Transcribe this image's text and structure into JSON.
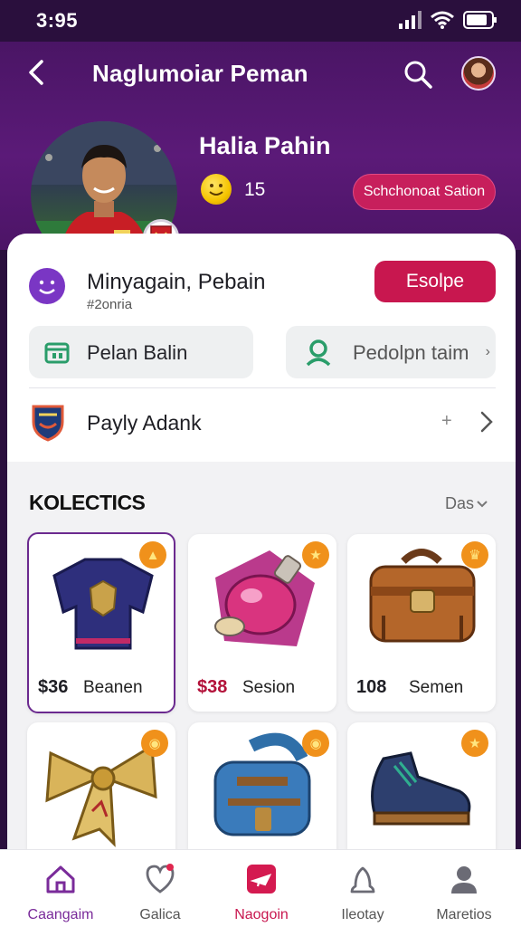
{
  "status": {
    "time": "3:95"
  },
  "header": {
    "title": "Naglumoiar Peman",
    "player_name": "Halia Pahin",
    "coins": "15",
    "pill_label": "Schchonoat Sation"
  },
  "user_row": {
    "name": "Minyagain, Pebain",
    "sub": "#2onria",
    "button": "Esolpe"
  },
  "actions": [
    {
      "label": "Pelan Balin"
    },
    {
      "label": "Pedolpn taim"
    }
  ],
  "team_row": {
    "label": "Payly Adank"
  },
  "collection": {
    "title": "KOLECTICS",
    "sort_label": "Das",
    "items": [
      {
        "price": "$36",
        "suffix": "Beanen",
        "icon": "jersey-icon"
      },
      {
        "price": "$38",
        "suffix": "Sesion",
        "icon": "potion-icon"
      },
      {
        "price": "108",
        "suffix": "Semen",
        "icon": "bag-icon"
      },
      {
        "price": "",
        "suffix": "",
        "icon": "ribbon-icon"
      },
      {
        "price": "",
        "suffix": "",
        "icon": "backpack-icon"
      },
      {
        "price": "",
        "suffix": "",
        "icon": "boots-icon"
      }
    ]
  },
  "nav": [
    {
      "label": "Caangaim",
      "icon": "home-icon",
      "active": true
    },
    {
      "label": "Galica",
      "icon": "heart-icon"
    },
    {
      "label": "Naogoin",
      "icon": "plane-icon"
    },
    {
      "label": "Ileotay",
      "icon": "bell-icon"
    },
    {
      "label": "Maretios",
      "icon": "profile-icon"
    }
  ],
  "colors": {
    "header": "#5b1a78",
    "accent": "#c8174f",
    "coin": "#f5c400",
    "rarity": "#f0911b"
  }
}
